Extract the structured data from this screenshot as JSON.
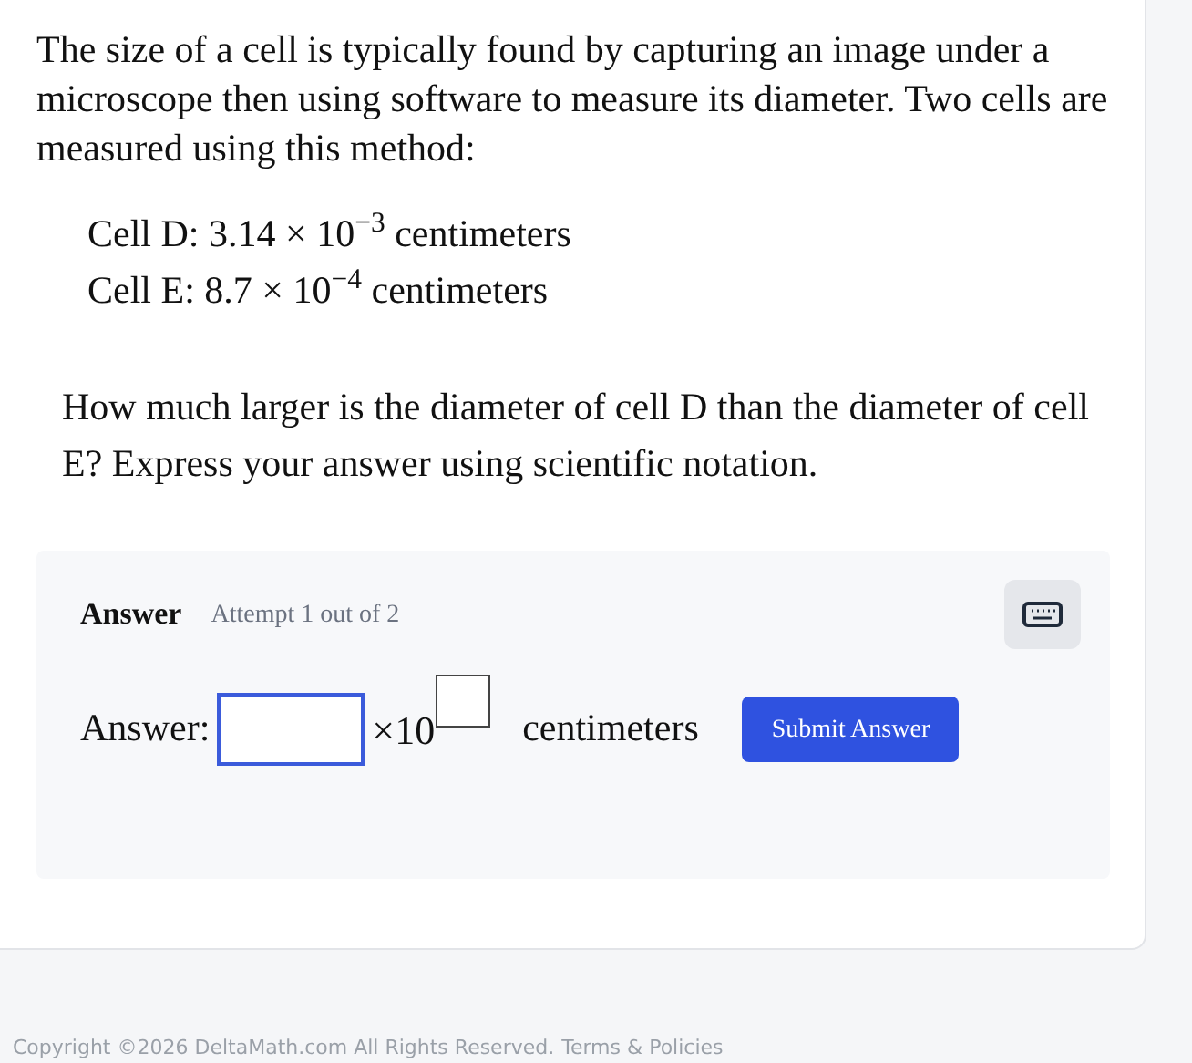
{
  "question": {
    "intro": "The size of a cell is typically found by capturing an image under a microscope then using software to measure its diameter. Two cells are measured using this method:",
    "measurements": [
      "Cell D: 3.14 × 10$^{−3}$ centimeters",
      "Cell E: 8.7 × 10$^{−4}$ centimeters"
    ],
    "prompt": "How much larger is the diameter of cell D than the diameter of cell E? Express your answer using scientific notation."
  },
  "answer_panel": {
    "heading": "Answer",
    "attempt": "Attempt 1 out of 2",
    "label": "Answer:",
    "times_ten": "×10",
    "unit": "centimeters",
    "submit": "Submit Answer"
  },
  "footer": {
    "copyright": "Copyright ©2026 DeltaMath.com All Rights Reserved.",
    "link": "Terms & Policies"
  }
}
